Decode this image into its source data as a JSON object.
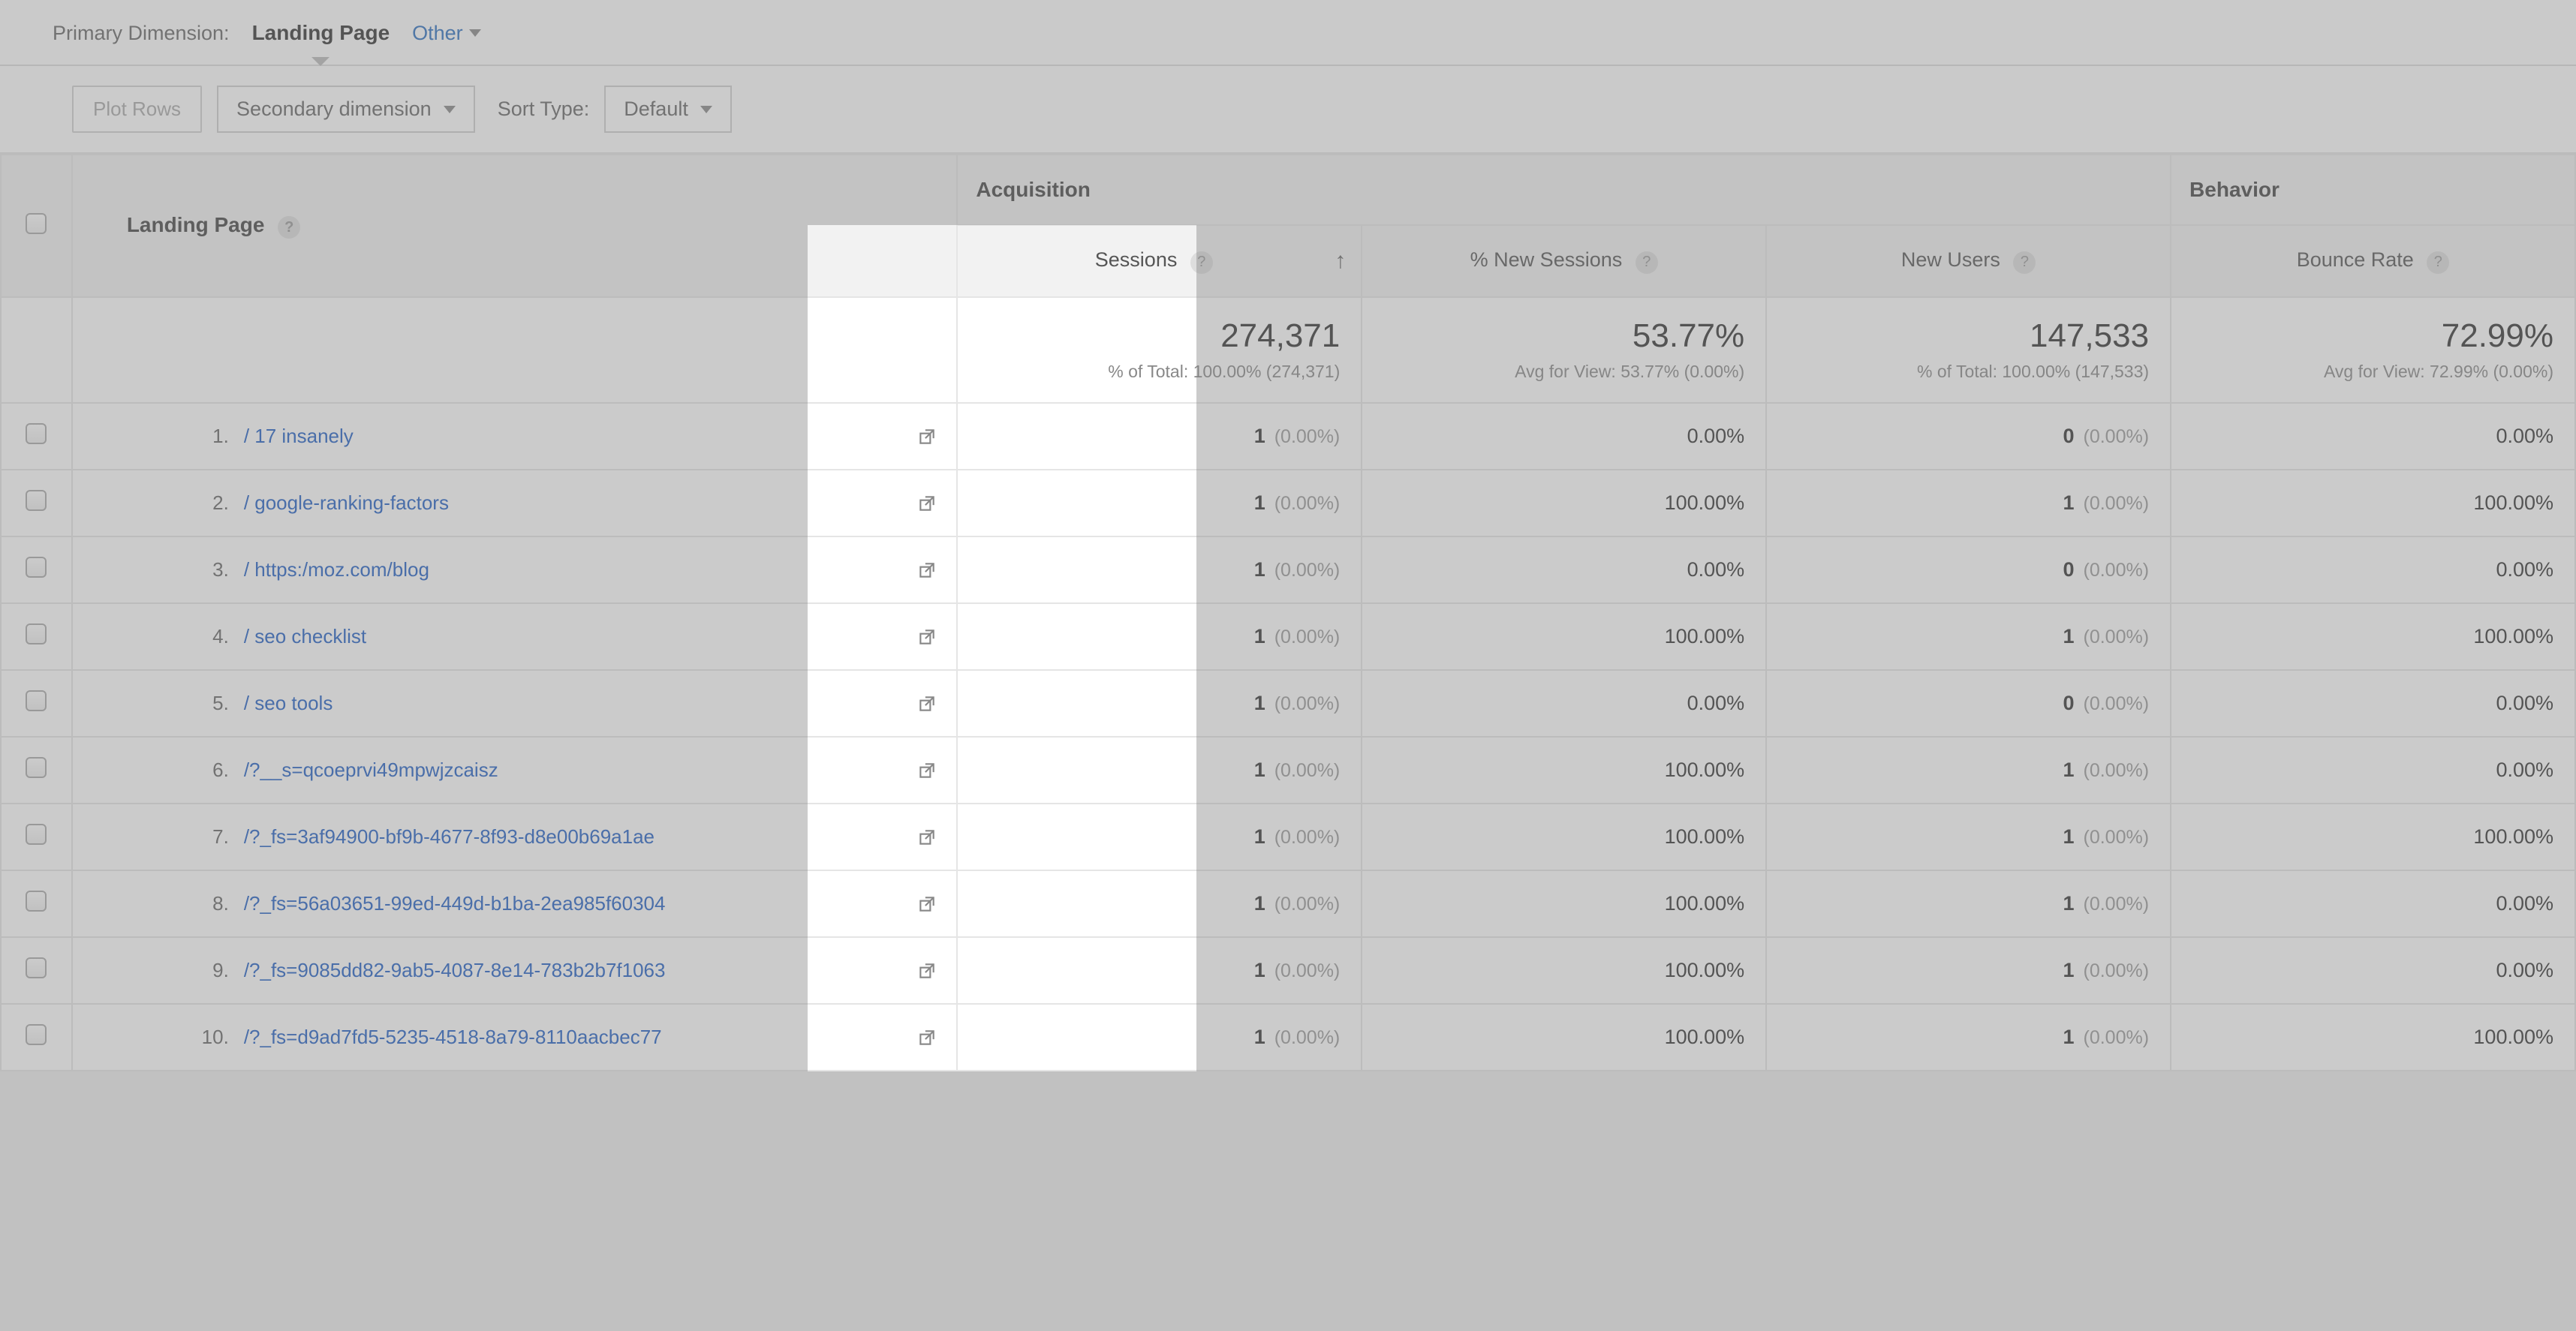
{
  "dimension": {
    "label": "Primary Dimension:",
    "active": "Landing Page",
    "other": "Other"
  },
  "toolbar": {
    "plot_rows": "Plot Rows",
    "secondary_dimension": "Secondary dimension",
    "sort_type_label": "Sort Type:",
    "sort_default": "Default"
  },
  "headers": {
    "landing_page": "Landing Page",
    "acquisition": "Acquisition",
    "behavior": "Behavior",
    "sessions": "Sessions",
    "pct_new_sessions": "% New Sessions",
    "new_users": "New Users",
    "bounce_rate": "Bounce Rate"
  },
  "summary": {
    "sessions_value": "274,371",
    "sessions_sub": "% of Total: 100.00% (274,371)",
    "pct_new_value": "53.77%",
    "pct_new_sub": "Avg for View: 53.77% (0.00%)",
    "new_users_value": "147,533",
    "new_users_sub": "% of Total: 100.00% (147,533)",
    "bounce_value": "72.99%",
    "bounce_sub": "Avg for View: 72.99% (0.00%)"
  },
  "rows": [
    {
      "n": "1.",
      "page": "/ 17 insanely",
      "sessions": "1",
      "sessions_pct": "(0.00%)",
      "pct_new": "0.00%",
      "new_users": "0",
      "new_users_pct": "(0.00%)",
      "bounce": "0.00%"
    },
    {
      "n": "2.",
      "page": "/ google-ranking-factors",
      "sessions": "1",
      "sessions_pct": "(0.00%)",
      "pct_new": "100.00%",
      "new_users": "1",
      "new_users_pct": "(0.00%)",
      "bounce": "100.00%"
    },
    {
      "n": "3.",
      "page": "/ https:/moz.com/blog",
      "sessions": "1",
      "sessions_pct": "(0.00%)",
      "pct_new": "0.00%",
      "new_users": "0",
      "new_users_pct": "(0.00%)",
      "bounce": "0.00%"
    },
    {
      "n": "4.",
      "page": "/ seo checklist",
      "sessions": "1",
      "sessions_pct": "(0.00%)",
      "pct_new": "100.00%",
      "new_users": "1",
      "new_users_pct": "(0.00%)",
      "bounce": "100.00%"
    },
    {
      "n": "5.",
      "page": "/ seo tools",
      "sessions": "1",
      "sessions_pct": "(0.00%)",
      "pct_new": "0.00%",
      "new_users": "0",
      "new_users_pct": "(0.00%)",
      "bounce": "0.00%"
    },
    {
      "n": "6.",
      "page": "/?__s=qcoeprvi49mpwjzcaisz",
      "sessions": "1",
      "sessions_pct": "(0.00%)",
      "pct_new": "100.00%",
      "new_users": "1",
      "new_users_pct": "(0.00%)",
      "bounce": "0.00%"
    },
    {
      "n": "7.",
      "page": "/?_fs=3af94900-bf9b-4677-8f93-d8e00b69a1ae",
      "sessions": "1",
      "sessions_pct": "(0.00%)",
      "pct_new": "100.00%",
      "new_users": "1",
      "new_users_pct": "(0.00%)",
      "bounce": "100.00%"
    },
    {
      "n": "8.",
      "page": "/?_fs=56a03651-99ed-449d-b1ba-2ea985f60304",
      "sessions": "1",
      "sessions_pct": "(0.00%)",
      "pct_new": "100.00%",
      "new_users": "1",
      "new_users_pct": "(0.00%)",
      "bounce": "0.00%"
    },
    {
      "n": "9.",
      "page": "/?_fs=9085dd82-9ab5-4087-8e14-783b2b7f1063",
      "sessions": "1",
      "sessions_pct": "(0.00%)",
      "pct_new": "100.00%",
      "new_users": "1",
      "new_users_pct": "(0.00%)",
      "bounce": "0.00%"
    },
    {
      "n": "10.",
      "page": "/?_fs=d9ad7fd5-5235-4518-8a79-8110aacbec77",
      "sessions": "1",
      "sessions_pct": "(0.00%)",
      "pct_new": "100.00%",
      "new_users": "1",
      "new_users_pct": "(0.00%)",
      "bounce": "100.00%"
    }
  ]
}
